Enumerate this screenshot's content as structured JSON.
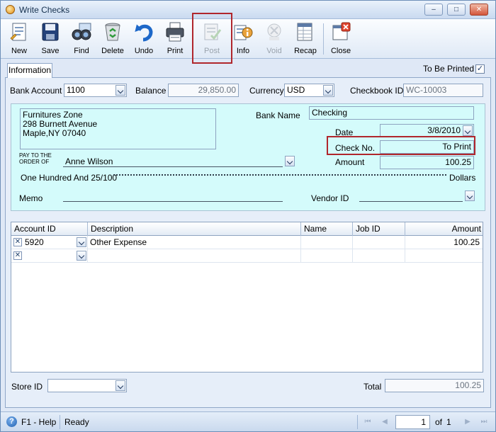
{
  "window": {
    "title": "Write Checks",
    "controls": [
      "–",
      "□",
      "✕"
    ]
  },
  "toolbar": {
    "buttons": [
      {
        "label": "New",
        "icon": "new-document-icon",
        "enabled": true
      },
      {
        "label": "Save",
        "icon": "floppy-disk-icon",
        "enabled": true
      },
      {
        "label": "Find",
        "icon": "binoculars-icon",
        "enabled": true
      },
      {
        "label": "Delete",
        "icon": "recycle-bin-icon",
        "enabled": true
      },
      {
        "label": "Undo",
        "icon": "undo-arrow-icon",
        "enabled": true
      },
      {
        "label": "Print",
        "icon": "printer-icon",
        "enabled": true
      },
      {
        "label": "Post",
        "icon": "post-icon",
        "enabled": false
      },
      {
        "label": "Info",
        "icon": "info-icon",
        "enabled": true
      },
      {
        "label": "Void",
        "icon": "void-icon",
        "enabled": false
      },
      {
        "label": "Recap",
        "icon": "recap-grid-icon",
        "enabled": true
      },
      {
        "label": "Close",
        "icon": "close-window-icon",
        "enabled": true
      }
    ]
  },
  "tab": {
    "label": "Information"
  },
  "to_be_printed": {
    "label": "To Be Printed",
    "checked": true
  },
  "header": {
    "bank_account_label": "Bank Account",
    "bank_account_value": "1100",
    "balance_label": "Balance",
    "balance_value": "29,850.00",
    "currency_label": "Currency",
    "currency_value": "USD",
    "checkbook_label": "Checkbook ID",
    "checkbook_value": "WC-10003"
  },
  "check": {
    "address_lines": [
      "Furnitures Zone",
      "298 Burnett Avenue",
      "Maple,NY 07040"
    ],
    "bank_name_label": "Bank Name",
    "bank_name_value": "Checking",
    "date_label": "Date",
    "date_value": "3/8/2010",
    "check_no_label": "Check No.",
    "check_no_value": "To Print",
    "amount_label": "Amount",
    "amount_value": "100.25",
    "pay_to_label_1": "PAY TO THE",
    "pay_to_label_2": "ORDER OF",
    "payee": "Anne Wilson",
    "amount_words": "One Hundred  And 25/100",
    "dollars_label": "Dollars",
    "memo_label": "Memo",
    "vendor_label": "Vendor ID"
  },
  "grid": {
    "columns": [
      "Account ID",
      "Description",
      "Name",
      "Job ID",
      "Amount"
    ],
    "rows": [
      {
        "account": "5920",
        "description": "Other Expense",
        "name": "",
        "job": "",
        "amount": "100.25"
      },
      {
        "account": "",
        "description": "",
        "name": "",
        "job": "",
        "amount": ""
      }
    ]
  },
  "footer": {
    "store_label": "Store ID",
    "store_value": "",
    "total_label": "Total",
    "total_value": "100.25"
  },
  "statusbar": {
    "help": "F1 - Help",
    "status": "Ready",
    "page": "1",
    "of_label": "of",
    "total_pages": "1"
  }
}
